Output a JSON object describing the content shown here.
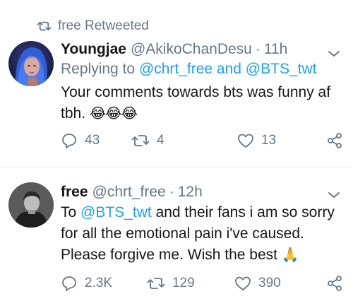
{
  "retweet_label": "free Retweeted",
  "tweets": [
    {
      "name": "Youngjae",
      "handle": "@AkikoChanDesu",
      "separator": "·",
      "time": "11h",
      "replying_prefix": "Replying to",
      "replying_handles": "@chrt_free and @BTS_twt",
      "text": "Your comments towards bts was funny af tbh.",
      "emoji": "😂😂😂",
      "replies": "43",
      "retweets": "4",
      "likes": "13"
    },
    {
      "name": "free",
      "handle": "@chrt_free",
      "separator": "·",
      "time": "12h",
      "text_pre": "To",
      "text_mention": "@BTS_twt",
      "text_post": "and their fans i am so sorry for all the emotional pain i've caused. Please forgive me. Wish the best",
      "emoji": "🙏",
      "replies": "2.3K",
      "retweets": "129",
      "likes": "390"
    }
  ],
  "colors": {
    "accent": "#1da1f2",
    "secondary_text": "#657786",
    "primary_text": "#14171a",
    "divider": "#e6ecf0"
  },
  "icons": [
    "retweet-icon",
    "chevron-down-icon",
    "reply-icon",
    "heart-icon",
    "share-icon"
  ]
}
